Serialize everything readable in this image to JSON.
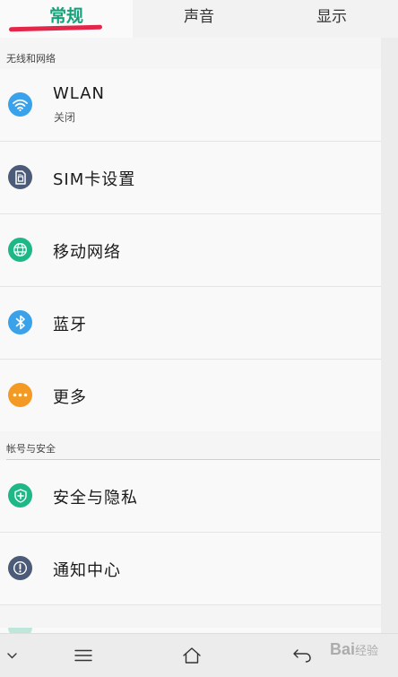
{
  "tabs": [
    {
      "label": "常规",
      "active": true
    },
    {
      "label": "声音",
      "active": false
    },
    {
      "label": "显示",
      "active": false
    }
  ],
  "sections": [
    {
      "header": "无线和网络",
      "items": [
        {
          "label": "WLAN",
          "sublabel": "关闭",
          "icon": "wifi-icon",
          "color": "#3aa2ea"
        },
        {
          "label": "SIM卡设置",
          "icon": "sim-card-icon",
          "color": "#4c5b78"
        },
        {
          "label": "移动网络",
          "icon": "globe-icon",
          "color": "#1db886"
        },
        {
          "label": "蓝牙",
          "icon": "bluetooth-icon",
          "color": "#3aa2ea"
        },
        {
          "label": "更多",
          "icon": "more-icon",
          "color": "#f39a25"
        }
      ]
    },
    {
      "header": "帐号与安全",
      "items": [
        {
          "label": "安全与隐私",
          "icon": "shield-icon",
          "color": "#1db886"
        },
        {
          "label": "通知中心",
          "icon": "exclamation-icon",
          "color": "#4c5b78"
        }
      ]
    }
  ],
  "watermark": {
    "brand": "Bai",
    "suffix": "经验"
  },
  "colors": {
    "accent": "#12a37a",
    "underline": "#e3264a"
  }
}
